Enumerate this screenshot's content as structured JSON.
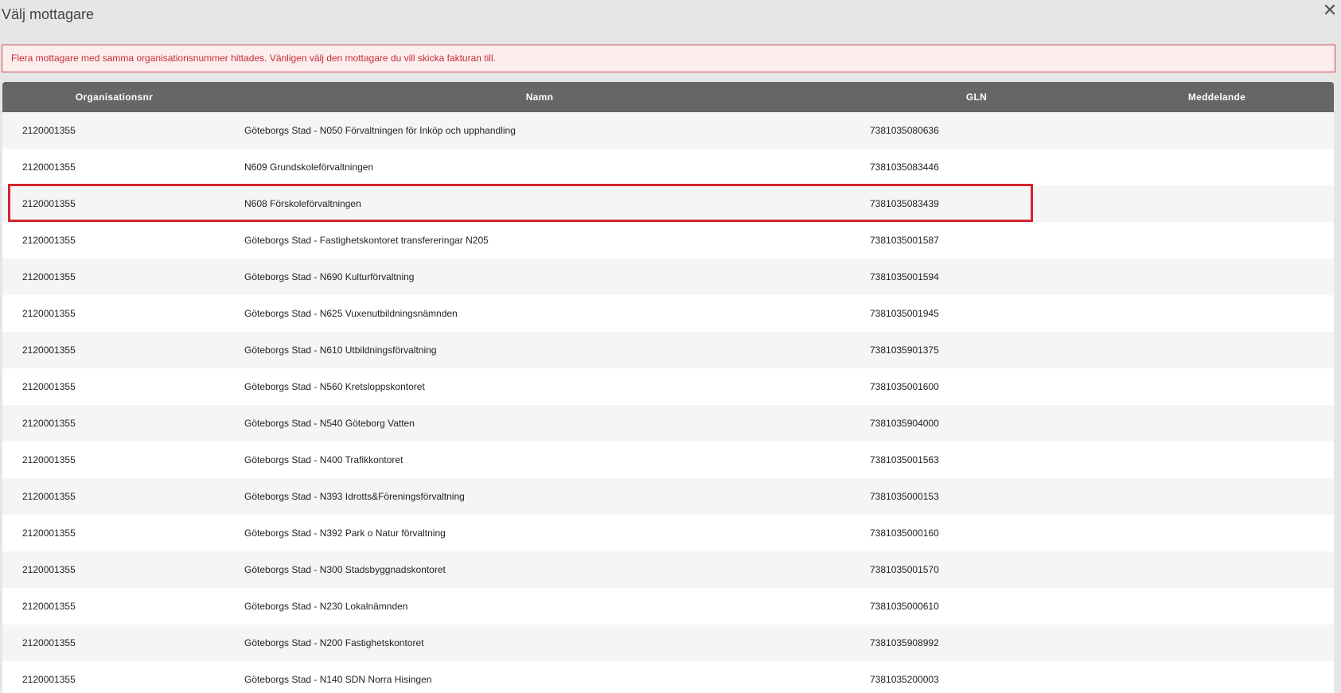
{
  "dialog": {
    "title": "Välj mottagare",
    "close_glyph": "✕"
  },
  "alert": {
    "message": "Flera mottagare med samma organisationsnummer hittades. Vänligen välj den mottagare du vill skicka fakturan till."
  },
  "table": {
    "headers": {
      "org": "Organisationsnr",
      "name": "Namn",
      "gln": "GLN",
      "message": "Meddelande"
    },
    "rows": [
      {
        "org": "2120001355",
        "name": "Göteborgs Stad - N050 Förvaltningen för Inköp och upphandling",
        "gln": "7381035080636",
        "message": ""
      },
      {
        "org": "2120001355",
        "name": "N609 Grundskoleförvaltningen",
        "gln": "7381035083446",
        "message": ""
      },
      {
        "org": "2120001355",
        "name": "N608 Förskoleförvaltningen",
        "gln": "7381035083439",
        "message": ""
      },
      {
        "org": "2120001355",
        "name": "Göteborgs Stad - Fastighetskontoret transfereringar N205",
        "gln": "7381035001587",
        "message": ""
      },
      {
        "org": "2120001355",
        "name": "Göteborgs Stad - N690 Kulturförvaltning",
        "gln": "7381035001594",
        "message": ""
      },
      {
        "org": "2120001355",
        "name": "Göteborgs Stad - N625 Vuxenutbildningsnämnden",
        "gln": "7381035001945",
        "message": ""
      },
      {
        "org": "2120001355",
        "name": "Göteborgs Stad - N610 Utbildningsförvaltning",
        "gln": "7381035901375",
        "message": ""
      },
      {
        "org": "2120001355",
        "name": "Göteborgs Stad - N560 Kretsloppskontoret",
        "gln": "7381035001600",
        "message": ""
      },
      {
        "org": "2120001355",
        "name": "Göteborgs Stad - N540 Göteborg Vatten",
        "gln": "7381035904000",
        "message": ""
      },
      {
        "org": "2120001355",
        "name": "Göteborgs Stad - N400 Trafikkontoret",
        "gln": "7381035001563",
        "message": ""
      },
      {
        "org": "2120001355",
        "name": "Göteborgs Stad - N393 Idrotts&Föreningsförvaltning",
        "gln": "7381035000153",
        "message": ""
      },
      {
        "org": "2120001355",
        "name": "Göteborgs Stad - N392 Park o Natur förvaltning",
        "gln": "7381035000160",
        "message": ""
      },
      {
        "org": "2120001355",
        "name": "Göteborgs Stad - N300 Stadsbyggnadskontoret",
        "gln": "7381035001570",
        "message": ""
      },
      {
        "org": "2120001355",
        "name": "Göteborgs Stad - N230 Lokalnämnden",
        "gln": "7381035000610",
        "message": ""
      },
      {
        "org": "2120001355",
        "name": "Göteborgs Stad - N200 Fastighetskontoret",
        "gln": "7381035908992",
        "message": ""
      },
      {
        "org": "2120001355",
        "name": "Göteborgs Stad - N140 SDN Norra Hisingen",
        "gln": "7381035200003",
        "message": ""
      }
    ]
  },
  "colors": {
    "header_bg": "#666666",
    "alert_border": "#d0454d",
    "alert_text": "#c42d35",
    "highlight": "#d8232c"
  }
}
